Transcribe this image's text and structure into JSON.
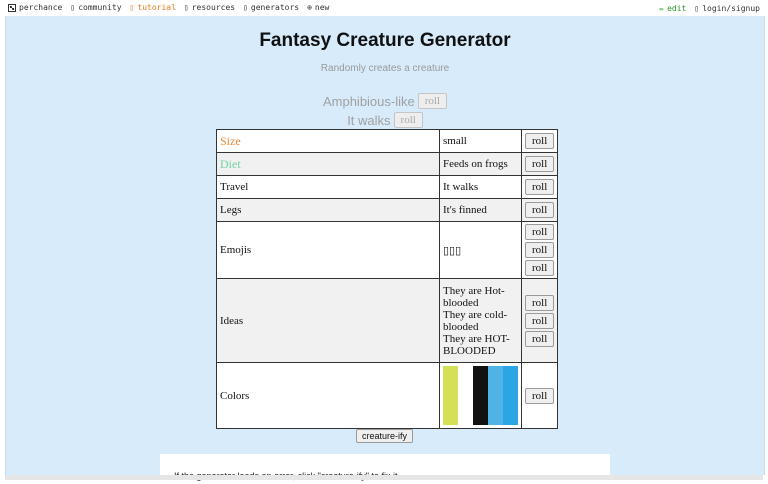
{
  "topbar": {
    "left": [
      {
        "label": "perchance",
        "icon": "dice-icon"
      },
      {
        "label": "community",
        "icon": "chat-icon"
      },
      {
        "label": "tutorial",
        "icon": "book-icon",
        "active": true
      },
      {
        "label": "resources",
        "icon": "link-icon"
      },
      {
        "label": "generators",
        "icon": "list-icon"
      },
      {
        "label": "new",
        "icon": "plus-circle-icon"
      }
    ],
    "right": [
      {
        "label": "edit",
        "icon": "pencil-icon"
      },
      {
        "label": "login/signup",
        "icon": "user-icon"
      }
    ]
  },
  "page": {
    "title": "Fantasy Creature Generator",
    "subtitle": "Randomly creates a creature",
    "faded_rows": [
      {
        "text": "Amphibious-like",
        "button": "roll"
      },
      {
        "text": "It walks",
        "button": "roll"
      }
    ],
    "creatify_button": "creature-ify",
    "note": "If the generator loads an error, click \"creature-ify\" to fix it."
  },
  "colors": {
    "accent_orange": "#e68a3a",
    "accent_green": "#6fd3a0",
    "background": "#d7ebfb"
  },
  "table": {
    "rows": [
      {
        "label": "Size",
        "value": "small",
        "buttons": [
          "roll"
        ]
      },
      {
        "label": "Diet",
        "value": "Feeds on frogs",
        "buttons": [
          "roll"
        ]
      },
      {
        "label": "Travel",
        "value": "It walks",
        "buttons": [
          "roll"
        ]
      },
      {
        "label": "Legs",
        "value": "It's finned",
        "buttons": [
          "roll"
        ]
      },
      {
        "label": "Emojis",
        "value": "▯▯▯",
        "buttons": [
          "roll",
          "roll",
          "roll"
        ]
      },
      {
        "label": "Ideas",
        "values": [
          "They are Hot-blooded",
          "They are cold-blooded",
          "They are HOT-BLOODED"
        ],
        "buttons": [
          "roll",
          "roll",
          "roll"
        ]
      },
      {
        "label": "Colors",
        "swatches": [
          "#d4e157",
          "#ffffff",
          "#111111",
          "#4fb3e6",
          "#29a6e3"
        ],
        "buttons": [
          "roll"
        ]
      }
    ]
  }
}
